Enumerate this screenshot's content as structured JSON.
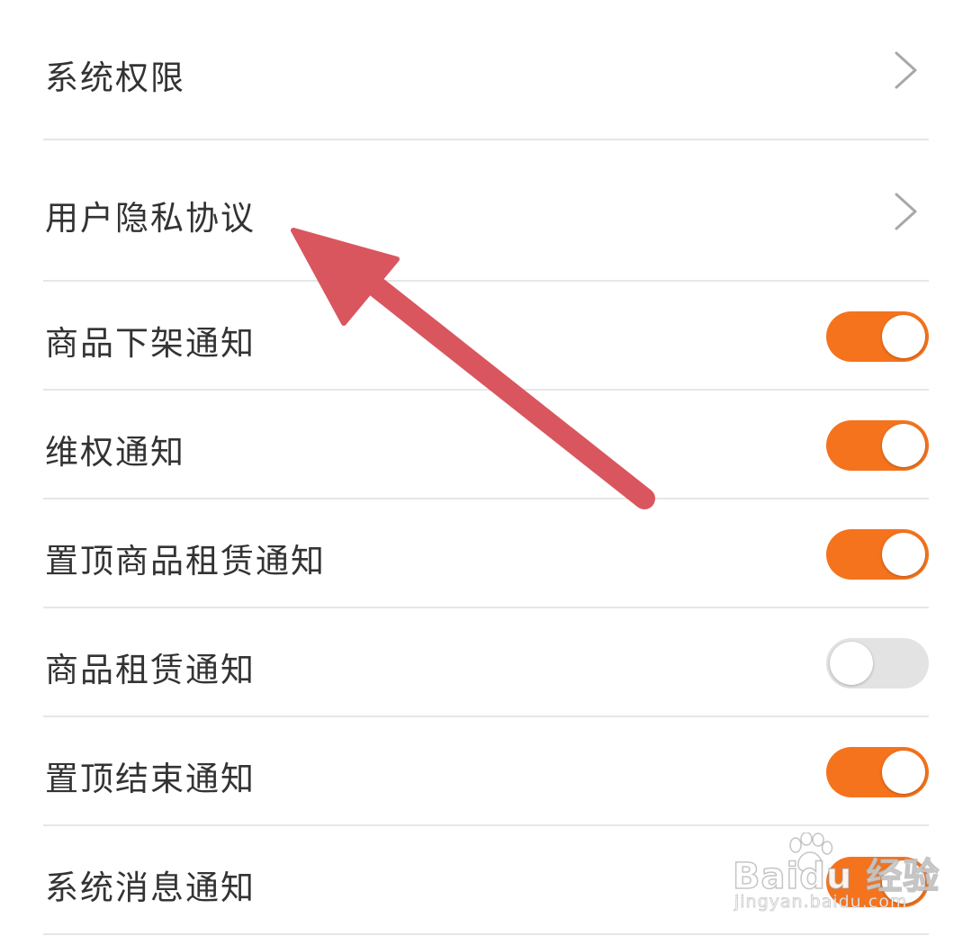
{
  "settings": {
    "items": [
      {
        "label": "系统权限",
        "control": "chevron"
      },
      {
        "label": "用户隐私协议",
        "control": "chevron"
      },
      {
        "label": "商品下架通知",
        "control": "toggle",
        "enabled": true
      },
      {
        "label": "维权通知",
        "control": "toggle",
        "enabled": true
      },
      {
        "label": "置顶商品租赁通知",
        "control": "toggle",
        "enabled": true
      },
      {
        "label": "商品租赁通知",
        "control": "toggle",
        "enabled": false
      },
      {
        "label": "置顶结束通知",
        "control": "toggle",
        "enabled": true
      },
      {
        "label": "系统消息通知",
        "control": "toggle",
        "enabled": true
      }
    ]
  },
  "colors": {
    "toggle_on": "#f5731d",
    "toggle_off": "#e3e3e3",
    "annotation_arrow": "#d9565f",
    "divider": "#e6e6e6",
    "label_text": "#333333"
  },
  "watermark": {
    "brand_text": "Baidu 经验",
    "site_text": "jingyan.baidu.com"
  }
}
